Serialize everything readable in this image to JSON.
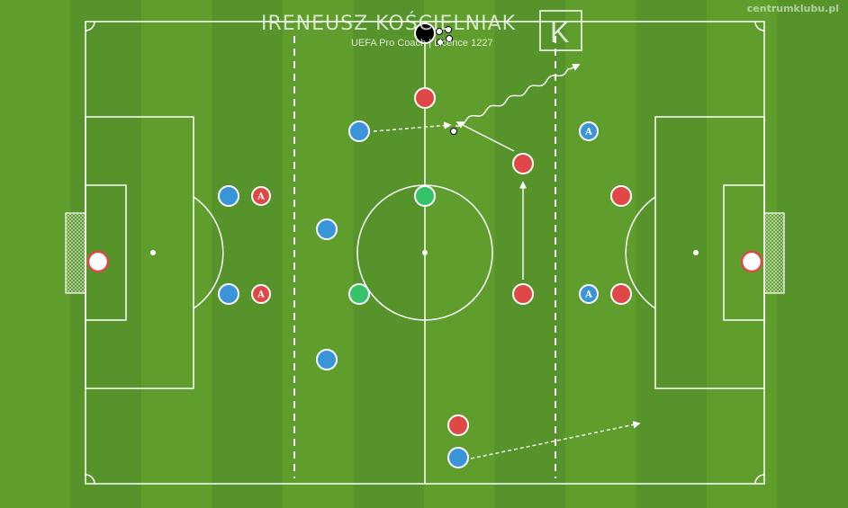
{
  "watermark": "centrumklubu.pl",
  "header": {
    "name": "IRENEUSZ KOŚCIELNIAK",
    "subtitle": "UEFA Pro Coach | Licence 1227",
    "logo_letter": "K"
  },
  "colors": {
    "pitch_light": "#5f9e2c",
    "pitch_dark": "#56932a",
    "line": "#ffffff",
    "red": "#e04848",
    "blue": "#3a95d8",
    "green": "#34c26a",
    "black": "#000000"
  },
  "players": [
    {
      "team": "red",
      "role": "goalkeeper",
      "label": "",
      "ring": true,
      "pos": "left goal"
    },
    {
      "team": "red",
      "role": "goalkeeper",
      "label": "",
      "ring": true,
      "pos": "right goal"
    },
    {
      "team": "blue",
      "label": "",
      "pos": "left half, top centre-back"
    },
    {
      "team": "red",
      "label": "A",
      "pos": "left half, top"
    },
    {
      "team": "blue",
      "label": "",
      "pos": "left half, bottom centre-back"
    },
    {
      "team": "red",
      "label": "A",
      "pos": "left half, bottom"
    },
    {
      "team": "blue",
      "label": "",
      "pos": "left midfield top"
    },
    {
      "team": "blue",
      "label": "",
      "pos": "left midfield centre"
    },
    {
      "team": "blue",
      "label": "",
      "pos": "left midfield bottom"
    },
    {
      "team": "green",
      "label": "",
      "pos": "centre-left"
    },
    {
      "team": "green",
      "label": "",
      "pos": "centre spot top"
    },
    {
      "team": "red",
      "label": "",
      "pos": "halfway top"
    },
    {
      "team": "red",
      "label": "",
      "pos": "right midfield upper"
    },
    {
      "team": "red",
      "label": "",
      "pos": "right midfield lower"
    },
    {
      "team": "red",
      "label": "",
      "pos": "bottom centre"
    },
    {
      "team": "blue",
      "label": "",
      "pos": "bottom with pass"
    },
    {
      "team": "blue",
      "label": "A",
      "pos": "right half top"
    },
    {
      "team": "red",
      "label": "",
      "pos": "right half centre-back"
    },
    {
      "team": "blue",
      "label": "A",
      "pos": "right half bottom"
    },
    {
      "team": "red",
      "label": "",
      "pos": "right half bottom centre-back"
    },
    {
      "team": "black",
      "label": "",
      "pos": "coach at halfway top"
    }
  ],
  "arrows": [
    {
      "style": "dashed",
      "meaning": "pass",
      "from": "blue left-midfield top",
      "to": "ball"
    },
    {
      "style": "solid",
      "meaning": "run",
      "from": "red right midfield upper",
      "to": "ball area"
    },
    {
      "style": "solid",
      "meaning": "run",
      "from": "red right midfield lower",
      "to": "upward"
    },
    {
      "style": "wavy",
      "meaning": "dribble",
      "from": "ball",
      "to": "right third top"
    },
    {
      "style": "dashed",
      "meaning": "pass",
      "from": "blue bottom",
      "to": "right third bottom"
    }
  ],
  "balls": {
    "count_near_coach": 4,
    "count_on_play": 1
  }
}
